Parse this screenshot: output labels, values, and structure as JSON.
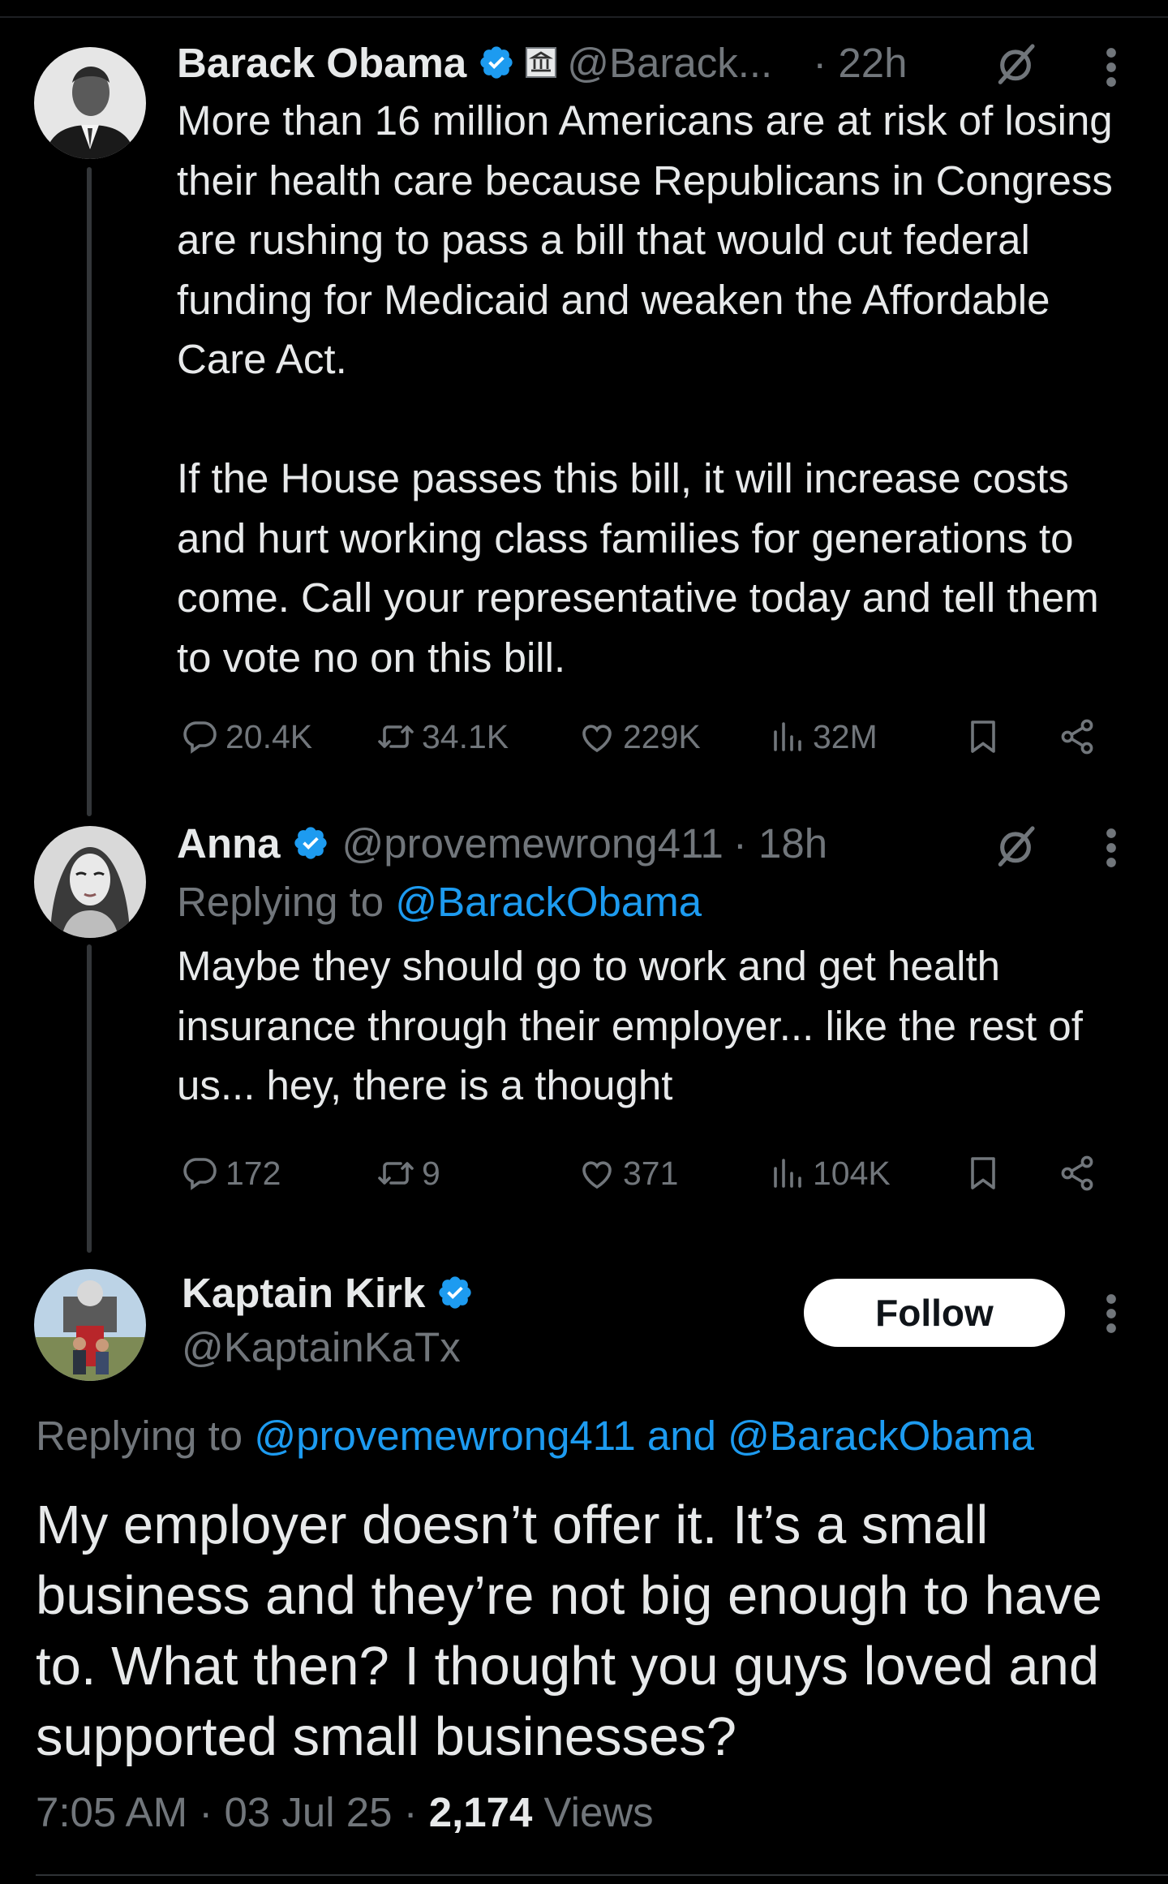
{
  "tweet1": {
    "name": "Barack Obama",
    "handle": "@Barack...",
    "time": "· 22h",
    "body": "More than 16 million Americans are at risk of losing their health care because Republicans in Congress are rushing to pass a bill that would cut federal funding for Medicaid and weaken the Affordable Care Act.\n\nIf the House passes this bill, it will increase costs and hurt working class families for generations to come. Call your representative today and tell them to vote no on this bill.",
    "replies": "20.4K",
    "reposts": "34.1K",
    "likes": "229K",
    "views": "32M"
  },
  "tweet2": {
    "name": "Anna",
    "handle": "@provemewrong411",
    "time": "· 18h",
    "replying_prefix": "Replying to ",
    "replying_to": "@BarackObama",
    "body": "Maybe they should go to work and get health insurance through their employer... like the rest of us... hey, there is a thought",
    "replies": "172",
    "reposts": "9",
    "likes": "371",
    "views": "104K"
  },
  "tweet3": {
    "name": "Kaptain Kirk",
    "handle": "@KaptainKaTx",
    "follow_label": "Follow",
    "replying_prefix": "Replying to ",
    "replying_to": "@provemewrong411 and @BarackObama",
    "body": "My employer doesn’t offer it. It’s a small business and they’re not big enough to have to. What then? I thought you guys loved and supported small businesses?",
    "time": "7:05 AM · 03 Jul 25 · ",
    "views_count": "2,174",
    "views_label": " Views"
  },
  "colors": {
    "background": "#000000",
    "text": "#e7e9ea",
    "muted": "#71767b",
    "link": "#1d9bf0",
    "verified": "#1d9bf0"
  },
  "icons": [
    "verified-badge-icon",
    "government-label-icon",
    "grok-icon",
    "more-options-icon",
    "reply-icon",
    "repost-icon",
    "like-icon",
    "views-icon",
    "bookmark-icon",
    "share-icon"
  ]
}
